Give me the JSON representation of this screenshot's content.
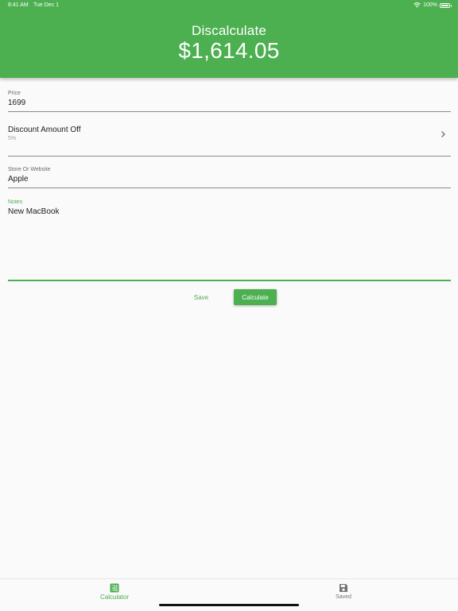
{
  "status_bar": {
    "time": "8:41 AM",
    "date": "Tue Dec 1",
    "battery": "100%"
  },
  "header": {
    "title": "Discalculate",
    "result": "$1,614.05"
  },
  "form": {
    "price": {
      "label": "Price",
      "value": "1699"
    },
    "discount": {
      "label": "Discount Amount Off",
      "value": "5%"
    },
    "store": {
      "label": "Store Or Website",
      "value": "Apple"
    },
    "notes": {
      "label": "Notes",
      "value": "New MacBook"
    }
  },
  "actions": {
    "save": "Save",
    "calculate": "Calculate"
  },
  "bottom_nav": {
    "items": [
      {
        "label": "Calculator",
        "icon": "calculator-icon",
        "active": true
      },
      {
        "label": "Saved",
        "icon": "save-icon",
        "active": false
      }
    ]
  },
  "colors": {
    "accent": "#4caf50",
    "background": "#fafafa",
    "inactive": "#757575"
  }
}
